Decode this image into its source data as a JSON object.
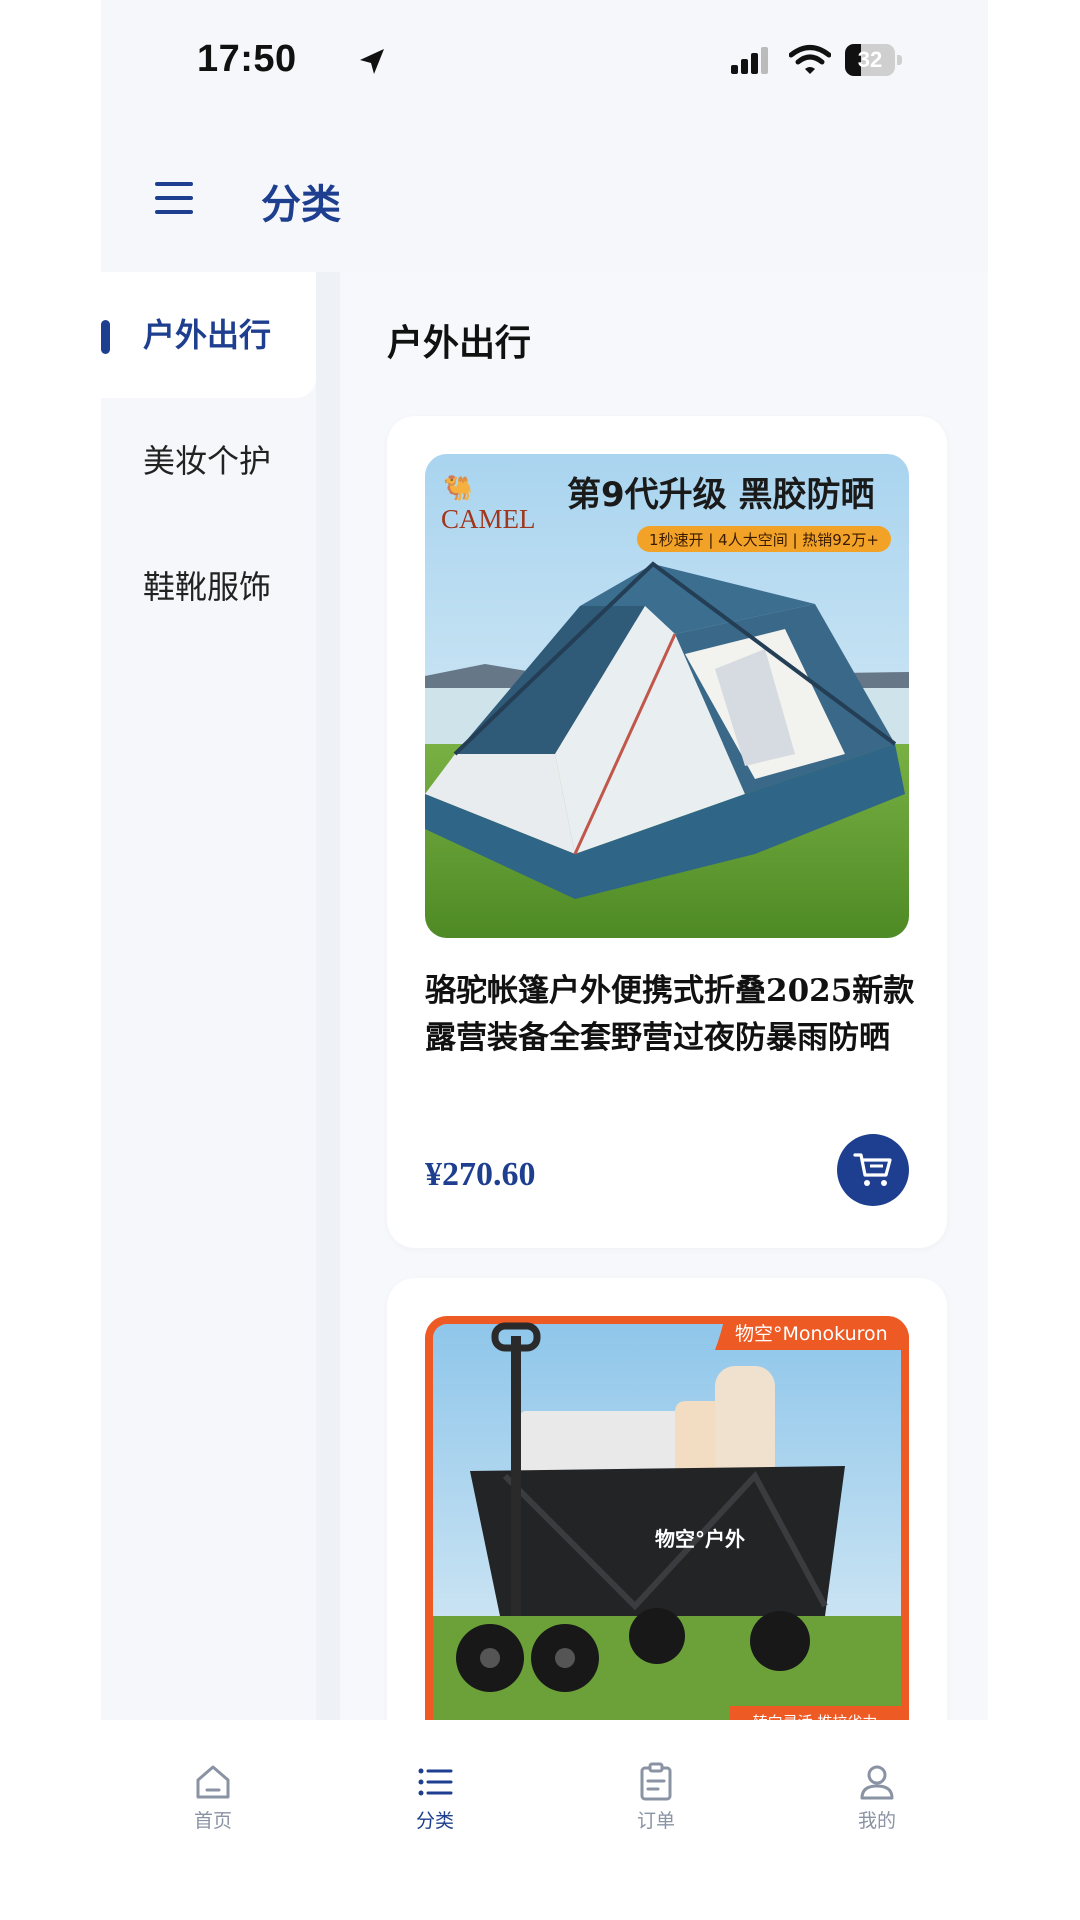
{
  "status_bar": {
    "time": "17:50",
    "battery": "32",
    "battery_level": 0.32
  },
  "header": {
    "title": "分类",
    "menu_icon": "hamburger-menu-icon"
  },
  "sidebar": {
    "items": [
      {
        "label": "户外出行",
        "active": true
      },
      {
        "label": "美妆个护",
        "active": false
      },
      {
        "label": "鞋靴服饰",
        "active": false
      }
    ]
  },
  "main": {
    "section_title": "户外出行",
    "products": [
      {
        "brand": "CAMEL",
        "banner_headline": "第9代升级 黑胶防晒",
        "banner_tagline": "1秒速开 | 4人大空间 | 热销92万+",
        "name": "骆驼帐篷户外便携式折叠2025新款露营装备全套野营过夜防暴雨防晒",
        "price": "¥270.60"
      },
      {
        "brand": "物空°Monokuron",
        "banner_tagline": "转向灵活 推拉省力",
        "cart_text": "物空°户外"
      }
    ]
  },
  "tabbar": {
    "tabs": [
      {
        "label": "首页",
        "icon": "home-icon",
        "active": false
      },
      {
        "label": "分类",
        "icon": "list-icon",
        "active": true
      },
      {
        "label": "订单",
        "icon": "clipboard-icon",
        "active": false
      },
      {
        "label": "我的",
        "icon": "user-icon",
        "active": false
      }
    ]
  },
  "colors": {
    "accent": "#1e3f8f",
    "background": "#f5f7fa",
    "card": "#ffffff"
  }
}
